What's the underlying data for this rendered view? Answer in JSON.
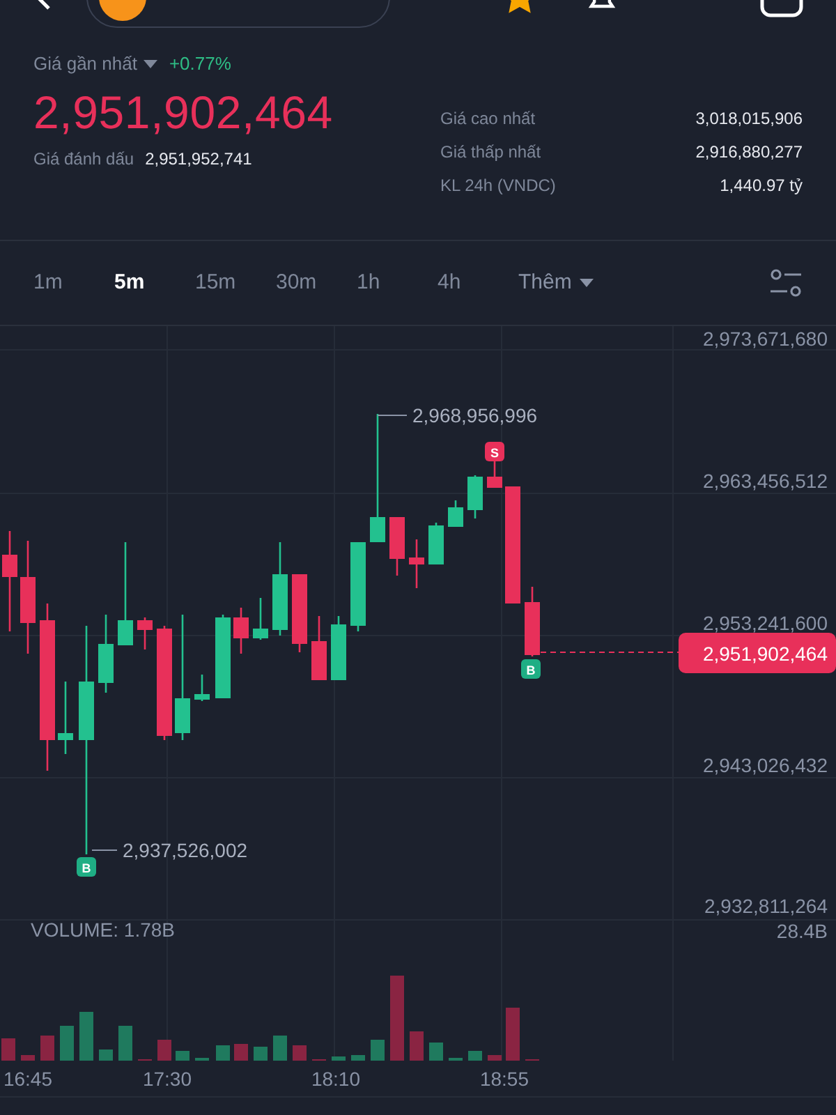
{
  "header": {
    "favorite": true
  },
  "ticker": {
    "last_price_label": "Giá gần nhất",
    "change": "+0.77%",
    "last_price": "2,951,902,464",
    "mark_price_label": "Giá đánh dấu",
    "mark_price": "2,951,952,741",
    "stats": [
      {
        "label": "Giá cao nhất",
        "value": "3,018,015,906"
      },
      {
        "label": "Giá thấp nhất",
        "value": "2,916,880,277"
      },
      {
        "label": "KL 24h (VNDC)",
        "value": "1,440.97 tỷ"
      }
    ]
  },
  "timeframes": [
    {
      "label": "1m",
      "selected": false
    },
    {
      "label": "5m",
      "selected": true
    },
    {
      "label": "15m",
      "selected": false
    },
    {
      "label": "30m",
      "selected": false
    },
    {
      "label": "1h",
      "selected": false
    },
    {
      "label": "4h",
      "selected": false
    }
  ],
  "more_label": "Thêm",
  "chart": {
    "price_axis": [
      "2,973,671,680",
      "2,963,456,512",
      "2,953,241,600",
      "2,943,026,432",
      "2,932,811,264"
    ],
    "high_label": "2,968,956,996",
    "low_label": "2,937,526,002",
    "current_price": "2,951,902,464",
    "markers": [
      {
        "text": "S",
        "kind": "sell"
      },
      {
        "text": "B",
        "kind": "buy"
      },
      {
        "text": "B",
        "kind": "buy"
      }
    ],
    "volume_label": "VOLUME: 1.78B",
    "volume_max": "28.4B",
    "time_axis": [
      "16:45",
      "17:30",
      "18:10",
      "18:55"
    ]
  }
}
